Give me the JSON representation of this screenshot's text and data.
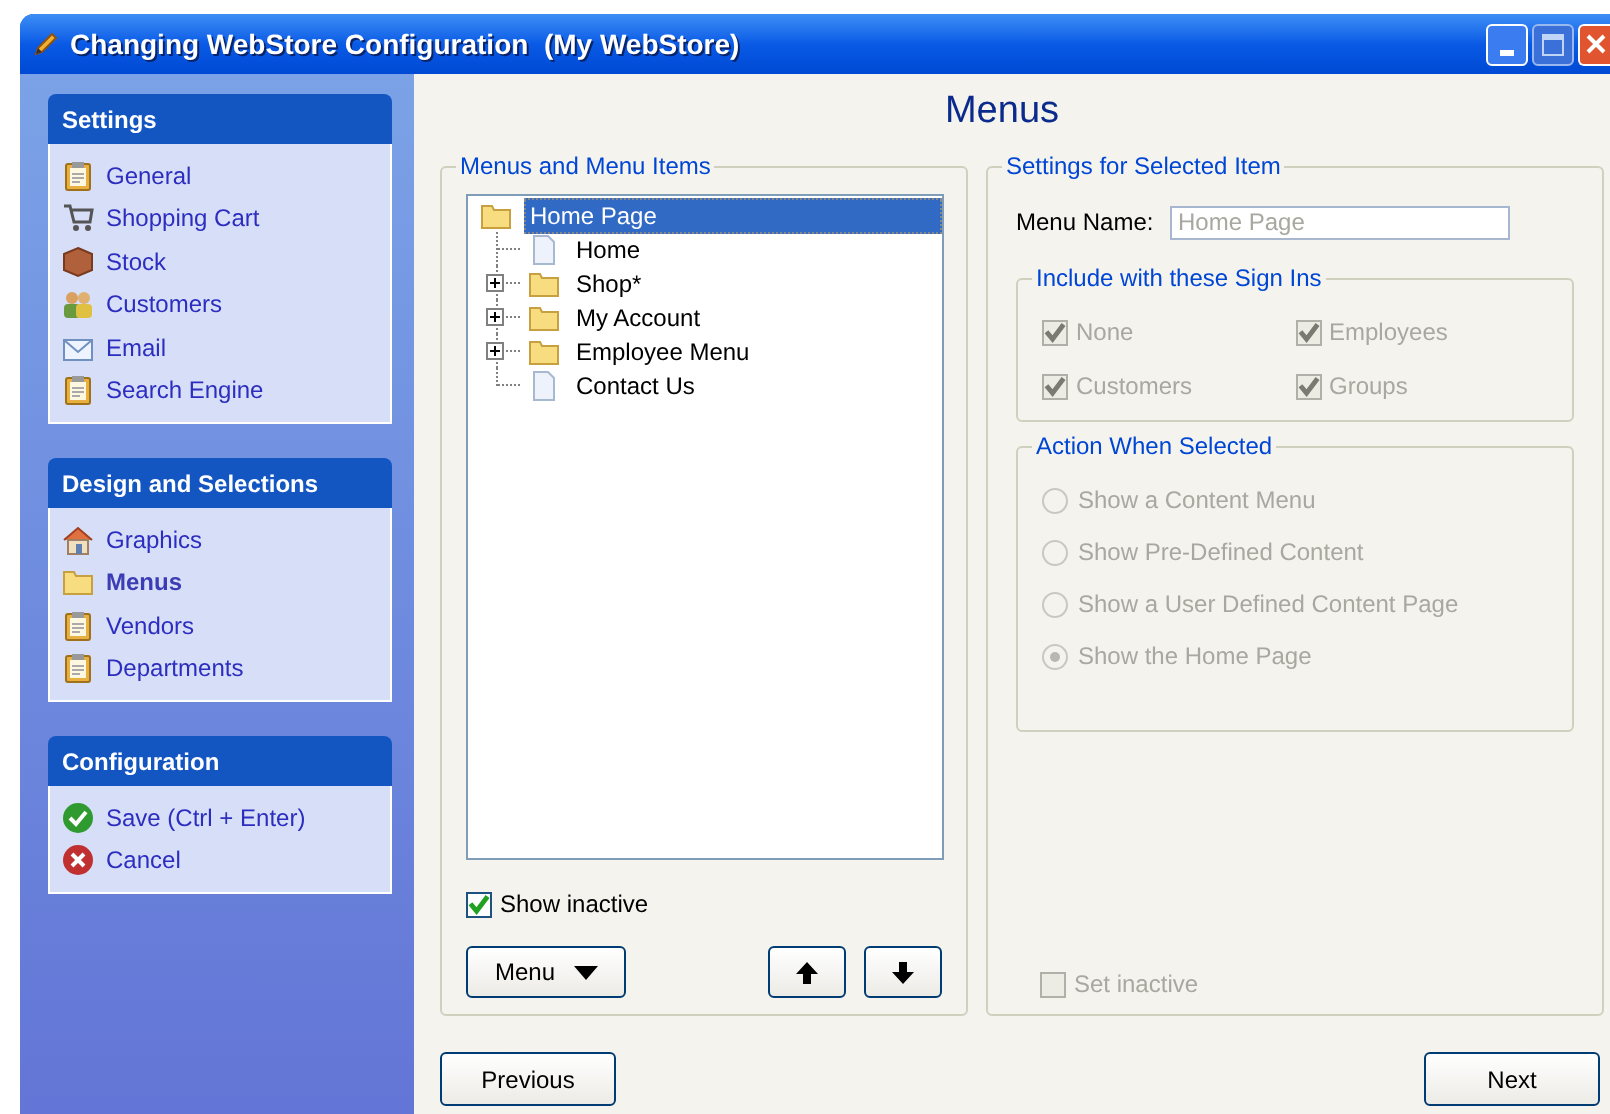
{
  "window": {
    "title": "Changing WebStore Configuration  (My WebStore)"
  },
  "sidebar": {
    "sections": [
      {
        "title": "Settings",
        "items": [
          {
            "label": "General",
            "selected": false
          },
          {
            "label": "Shopping Cart",
            "selected": false
          },
          {
            "label": "Stock",
            "selected": false
          },
          {
            "label": "Customers",
            "selected": false
          },
          {
            "label": "Email",
            "selected": false
          },
          {
            "label": "Search Engine",
            "selected": false
          }
        ]
      },
      {
        "title": "Design and Selections",
        "items": [
          {
            "label": "Graphics",
            "selected": false
          },
          {
            "label": "Menus",
            "selected": true
          },
          {
            "label": "Vendors",
            "selected": false
          },
          {
            "label": "Departments",
            "selected": false
          }
        ]
      },
      {
        "title": "Configuration",
        "items": [
          {
            "label": "Save (Ctrl + Enter)",
            "selected": false
          },
          {
            "label": "Cancel",
            "selected": false
          }
        ]
      }
    ]
  },
  "page_title": "Menus",
  "menus_panel": {
    "title": "Menus and Menu Items",
    "tree": [
      {
        "label": "Home Page",
        "kind": "folder",
        "selected": true,
        "children": [
          {
            "label": "Home",
            "kind": "page",
            "selected": false
          },
          {
            "label": "Shop*",
            "kind": "folder",
            "selected": false,
            "expanded": false
          },
          {
            "label": "My Account",
            "kind": "folder",
            "selected": false,
            "expanded": false
          },
          {
            "label": "Employee Menu",
            "kind": "folder",
            "selected": false,
            "expanded": false
          },
          {
            "label": "Contact Us",
            "kind": "page",
            "selected": false
          }
        ]
      }
    ],
    "show_inactive": {
      "label": "Show inactive",
      "checked": true
    },
    "menu_button": "Menu"
  },
  "settings_panel": {
    "title": "Settings for Selected Item",
    "menu_name": {
      "label": "Menu Name:",
      "value": "Home Page",
      "disabled": true
    },
    "sign_ins": {
      "title": "Include with these Sign Ins",
      "options": [
        {
          "label": "None",
          "checked": true
        },
        {
          "label": "Employees",
          "checked": true
        },
        {
          "label": "Customers",
          "checked": true
        },
        {
          "label": "Groups",
          "checked": true
        }
      ],
      "disabled": true
    },
    "action": {
      "title": "Action When Selected",
      "options": [
        {
          "label": "Show a Content Menu",
          "selected": false
        },
        {
          "label": "Show Pre-Defined Content",
          "selected": false
        },
        {
          "label": "Show a User Defined Content Page",
          "selected": false
        },
        {
          "label": "Show the Home Page",
          "selected": true
        }
      ],
      "disabled": true
    },
    "set_inactive": {
      "label": "Set inactive",
      "checked": false,
      "disabled": true
    }
  },
  "buttons": {
    "previous": "Previous",
    "next": "Next"
  }
}
